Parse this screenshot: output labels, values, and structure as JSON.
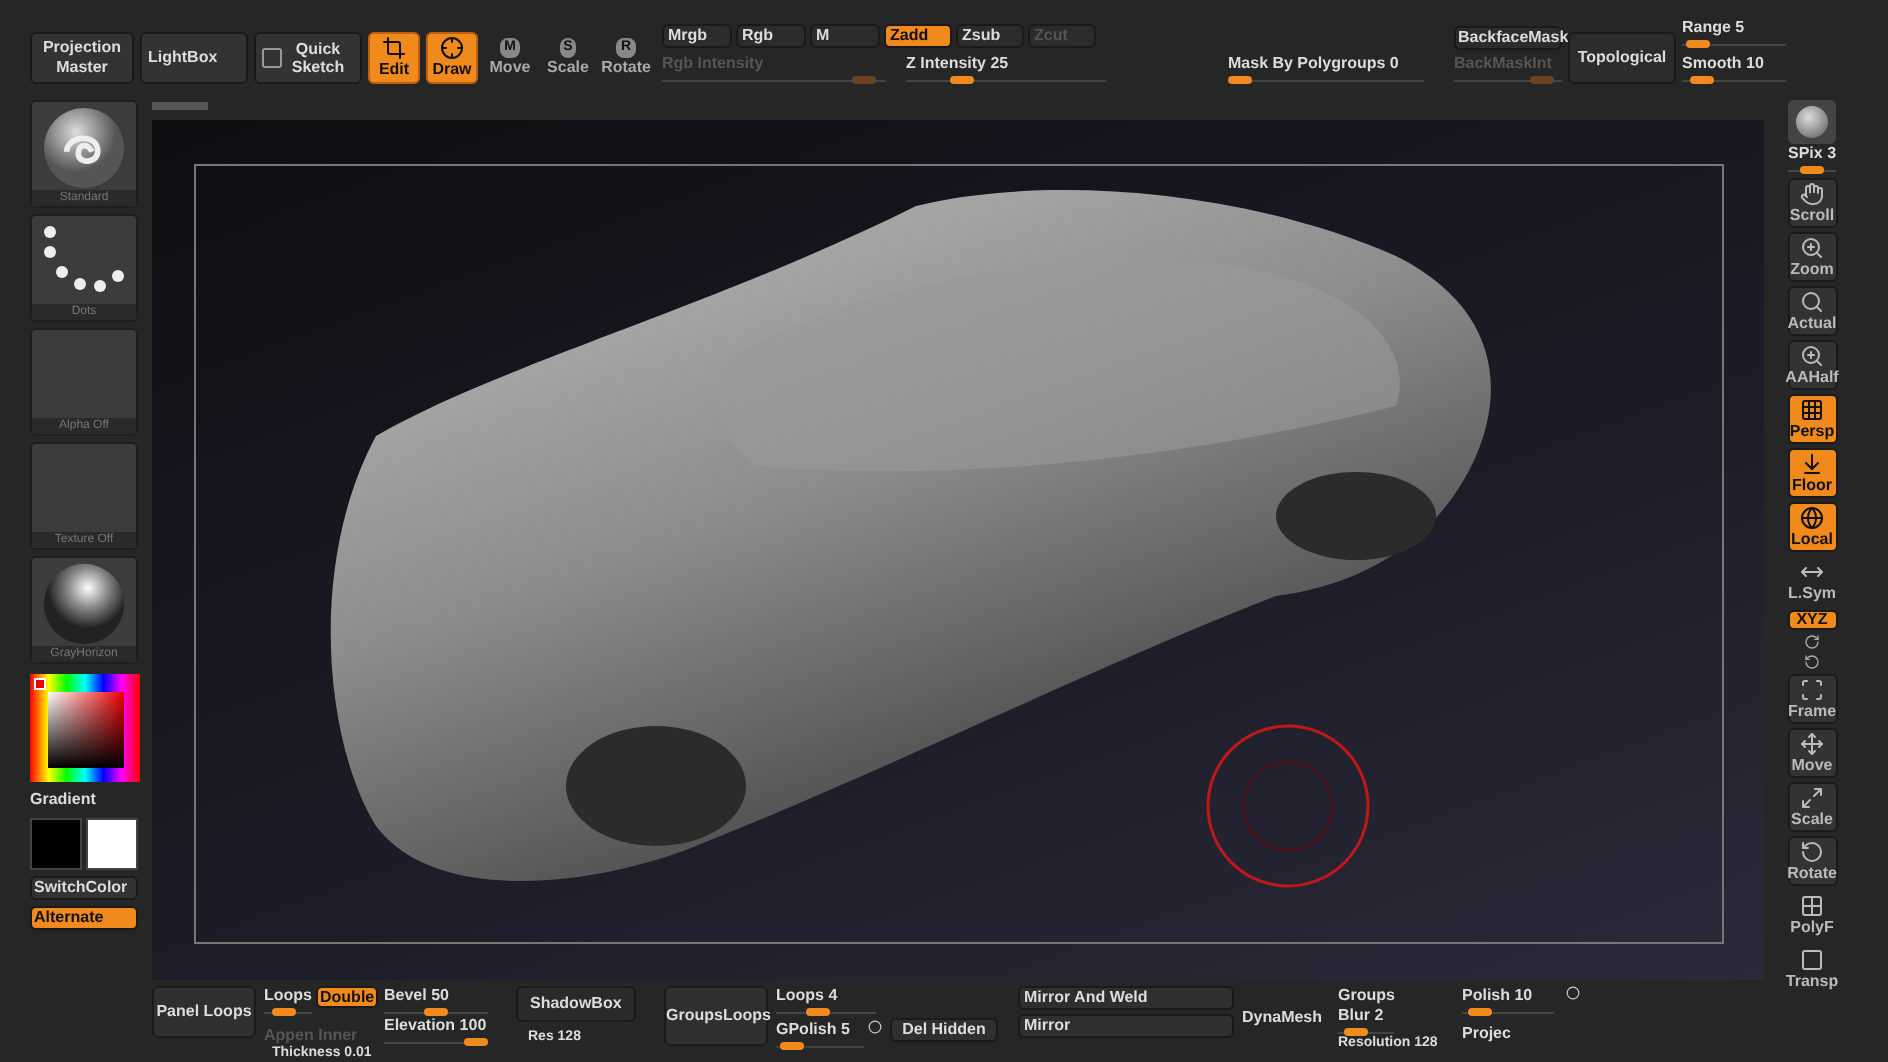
{
  "top_bar": {
    "projection_master": "Projection Master",
    "lightbox": "LightBox",
    "quick_sketch": "Quick Sketch",
    "tools": [
      {
        "label": "Edit",
        "selected": true
      },
      {
        "label": "Draw",
        "selected": true
      },
      {
        "label": "Move",
        "badge": "M",
        "selected": false
      },
      {
        "label": "Scale",
        "badge": "S",
        "selected": false
      },
      {
        "label": "Rotate",
        "badge": "R",
        "selected": false
      }
    ],
    "color_modes": [
      {
        "label": "Mrgb"
      },
      {
        "label": "Rgb"
      },
      {
        "label": "M"
      }
    ],
    "rgb_intensity": {
      "label": "Rgb Intensity",
      "disabled": true,
      "level": 0.95
    },
    "depth_modes": [
      {
        "label": "Zadd",
        "selected": true,
        "disabled": false
      },
      {
        "label": "Zsub",
        "selected": false,
        "disabled": false
      },
      {
        "label": "Zcut",
        "selected": false,
        "disabled": true
      }
    ],
    "z_intensity": {
      "label": "Z Intensity 25",
      "level": 0.25
    },
    "mask_by_polygroups": {
      "label": "Mask By Polygroups 0",
      "level": 0
    },
    "backface_mask": "BackfaceMask",
    "back_mask_int": {
      "label": "BackMaskInt",
      "disabled": true,
      "level": 0.9
    },
    "topological": "Topological",
    "range": {
      "label": "Range 5",
      "level": 0.05
    },
    "smooth": {
      "label": "Smooth 10",
      "level": 0.1
    }
  },
  "left_shelf": {
    "thumbnails": [
      {
        "label": "Standard",
        "kind": "brush"
      },
      {
        "label": "Dots",
        "kind": "stroke"
      },
      {
        "label": "Alpha Off",
        "kind": "empty"
      },
      {
        "label": "Texture Off",
        "kind": "empty"
      },
      {
        "label": "GrayHorizon",
        "kind": "material"
      }
    ],
    "gradient": "Gradient",
    "switch_color": "SwitchColor",
    "alternate": {
      "label": "Alternate",
      "on": true
    }
  },
  "right_shelf": [
    {
      "label": "SPix 3",
      "kind": "slider",
      "level": 0.5
    },
    {
      "label": "Scroll",
      "kind": "button",
      "on": false
    },
    {
      "label": "Zoom",
      "kind": "button",
      "on": false
    },
    {
      "label": "Actual",
      "kind": "button",
      "on": false
    },
    {
      "label": "AAHalf",
      "kind": "button",
      "on": false
    },
    {
      "label": "Persp",
      "kind": "button",
      "on": true
    },
    {
      "label": "Floor",
      "kind": "button",
      "on": true
    },
    {
      "label": "Local",
      "kind": "button",
      "on": true
    },
    {
      "label": "L.Sym",
      "kind": "plain",
      "on": false
    },
    {
      "label": "XYZ",
      "kind": "toggle",
      "on": true
    },
    {
      "label": "Frame",
      "kind": "button",
      "on": false
    },
    {
      "label": "Move",
      "kind": "button",
      "on": false
    },
    {
      "label": "Scale",
      "kind": "button",
      "on": false
    },
    {
      "label": "Rotate",
      "kind": "button",
      "on": false
    },
    {
      "label": "PolyF",
      "kind": "plain",
      "on": false
    },
    {
      "label": "Transp",
      "kind": "plain",
      "on": false
    }
  ],
  "bottom_bar": {
    "panel_loops": "Panel Loops",
    "loops": {
      "label": "Loops",
      "level": 0.3
    },
    "double": {
      "label": "Double",
      "on": true
    },
    "append_inner": {
      "label": "Appen Inner",
      "disabled": true
    },
    "bevel": {
      "label": "Bevel 50",
      "level": 0.5
    },
    "elevation": {
      "label": "Elevation 100",
      "level": 1
    },
    "thickness": "Thickness 0.01",
    "shadowbox": "ShadowBox",
    "res": "Res 128",
    "groups_loops": "GroupsLoops",
    "loops_count": {
      "label": "Loops 4",
      "level": 0.4
    },
    "gpolish": {
      "label": "GPolish 5",
      "level": 0.05
    },
    "del_hidden": "Del Hidden",
    "mirror_and_weld": "Mirror And Weld",
    "mirror": "Mirror",
    "dynamesh": "DynaMesh",
    "groups": "Groups",
    "blur": {
      "label": "Blur 2",
      "level": 0.2
    },
    "resolution": "Resolution 128",
    "polish": {
      "label": "Polish 10",
      "level": 0.1
    },
    "project": "Projec"
  }
}
